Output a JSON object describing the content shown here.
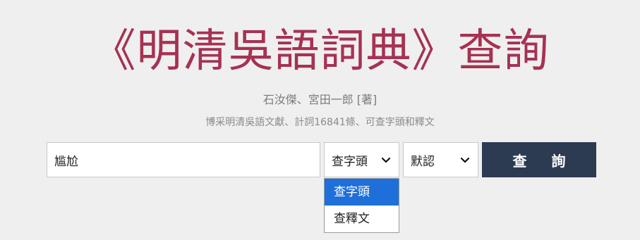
{
  "header": {
    "title": "《明清吳語詞典》查詢",
    "author": "石汝傑、宮田一郎 [著]",
    "subtitle": "博采明清吳語文獻、計詞16841條、可查字頭和釋文"
  },
  "search": {
    "value": "尴尬",
    "field_select": {
      "value": "查字頭",
      "options": [
        "查字頭",
        "查釋文"
      ]
    },
    "mode_select": {
      "value": "默認"
    },
    "button_label": "查 詢"
  },
  "colors": {
    "title": "#a63252",
    "button": "#2c3a52",
    "option_highlight": "#1e6fd9",
    "background": "#efefef"
  }
}
